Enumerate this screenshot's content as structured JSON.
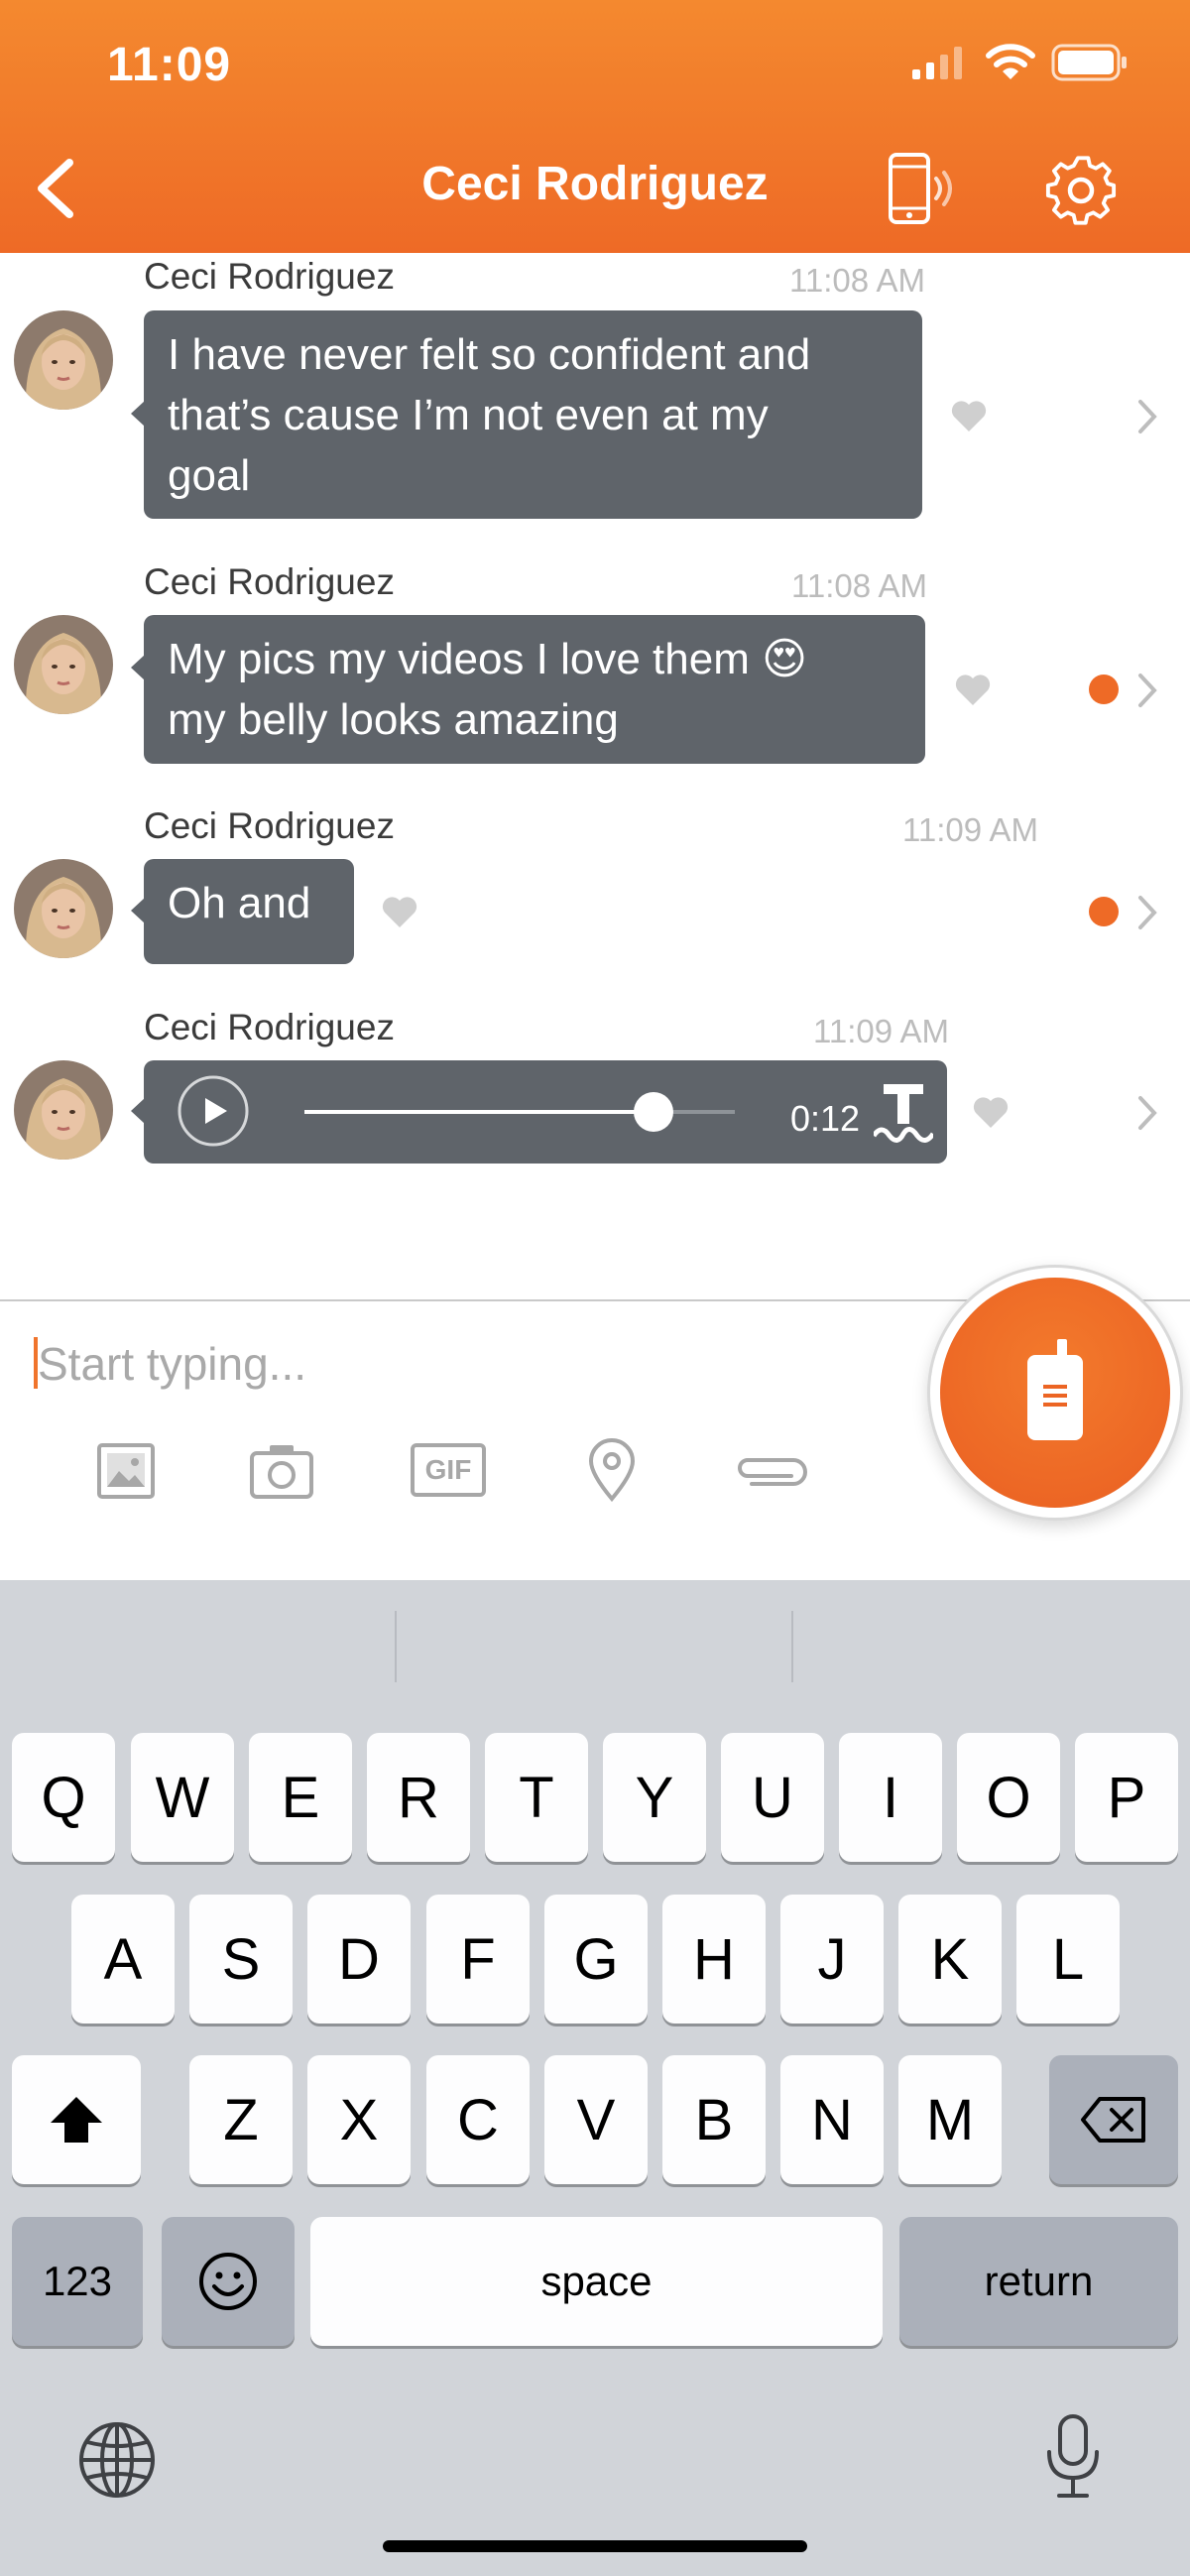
{
  "status_bar": {
    "time": "11:09"
  },
  "header": {
    "title": "Ceci Rodriguez",
    "icons": [
      "back-arrow-icon",
      "phone-vibrate-icon",
      "settings-gear-icon"
    ],
    "bg_color": "#ef7229"
  },
  "messages": [
    {
      "sender": "Ceci Rodriguez",
      "time": "11:08 AM",
      "lines": [
        "I have never felt so confident and",
        "that’s cause I’m not even at my",
        "goal"
      ],
      "unread": false
    },
    {
      "sender": "Ceci Rodriguez",
      "time": "11:08 AM",
      "lines": [
        "My pics my videos I love them 😍",
        "my belly looks amazing"
      ],
      "unread": true
    },
    {
      "sender": "Ceci Rodriguez",
      "time": "11:09 AM",
      "lines": [
        "Oh and"
      ],
      "unread": true
    },
    {
      "sender": "Ceci Rodriguez",
      "time": "11:09 AM",
      "voice": {
        "duration": "0:12",
        "progress": 0.81
      },
      "unread": false
    }
  ],
  "composer": {
    "placeholder": "Start typing...",
    "tools": [
      "image-icon",
      "camera-icon",
      "gif-icon",
      "location-pin-icon",
      "paperclip-icon"
    ],
    "gif_label": "GIF",
    "walkie_button_icon": "walkie-talkie-icon"
  },
  "keyboard": {
    "row1": [
      "Q",
      "W",
      "E",
      "R",
      "T",
      "Y",
      "U",
      "I",
      "O",
      "P"
    ],
    "row2": [
      "A",
      "S",
      "D",
      "F",
      "G",
      "H",
      "J",
      "K",
      "L"
    ],
    "row3": [
      "Z",
      "X",
      "C",
      "V",
      "B",
      "N",
      "M"
    ],
    "numbers_label": "123",
    "space_label": "space",
    "return_label": "return",
    "icons": [
      "shift-icon",
      "backspace-icon",
      "emoji-icon",
      "globe-icon",
      "microphone-icon"
    ]
  }
}
